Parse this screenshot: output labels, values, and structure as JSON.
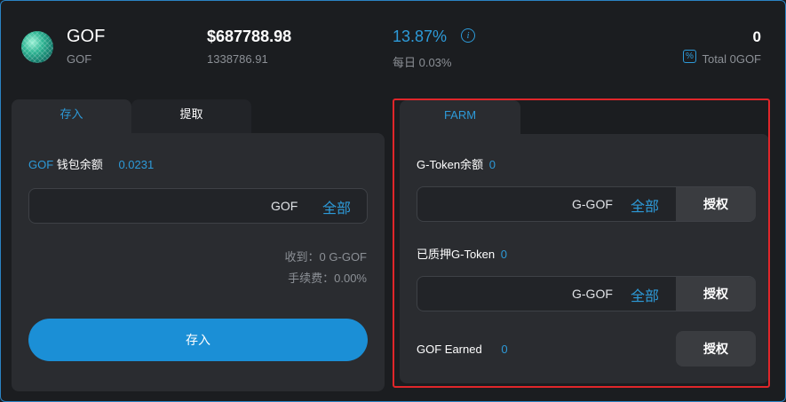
{
  "header": {
    "token_name": "GOF",
    "token_symbol": "GOF",
    "price": "$687788.98",
    "price_sub": "1338786.91",
    "apy": "13.87%",
    "daily": "每日 0.03%",
    "total_value": "0",
    "total_label": "Total 0GOF"
  },
  "left": {
    "tabs": [
      {
        "label": "存入",
        "active": true
      },
      {
        "label": "提取",
        "active": false
      }
    ],
    "wallet_token": "GOF",
    "wallet_label": "钱包余额",
    "wallet_value": "0.0231",
    "input_unit": "GOF",
    "input_all": "全部",
    "receive": "收到：0 G-GOF",
    "fee": "手续费：0.00%",
    "deposit_button": "存入"
  },
  "right": {
    "tab": "FARM",
    "gtoken_label": "G-Token余额",
    "gtoken_value": "0",
    "input1_unit": "G-GOF",
    "input1_all": "全部",
    "input1_button": "授权",
    "staked_label": "已质押G-Token",
    "staked_value": "0",
    "input2_unit": "G-GOF",
    "input2_all": "全部",
    "input2_button": "授权",
    "earned_label": "GOF Earned",
    "earned_value": "0",
    "earned_button": "授权"
  },
  "colors": {
    "accent": "#2d9ad8",
    "highlight": "#e0262a",
    "background": "#1b1d20",
    "panel": "#2a2c30"
  },
  "icons": {
    "info": "info-icon",
    "total": "percent-box-icon",
    "logo": "gof-logo"
  }
}
